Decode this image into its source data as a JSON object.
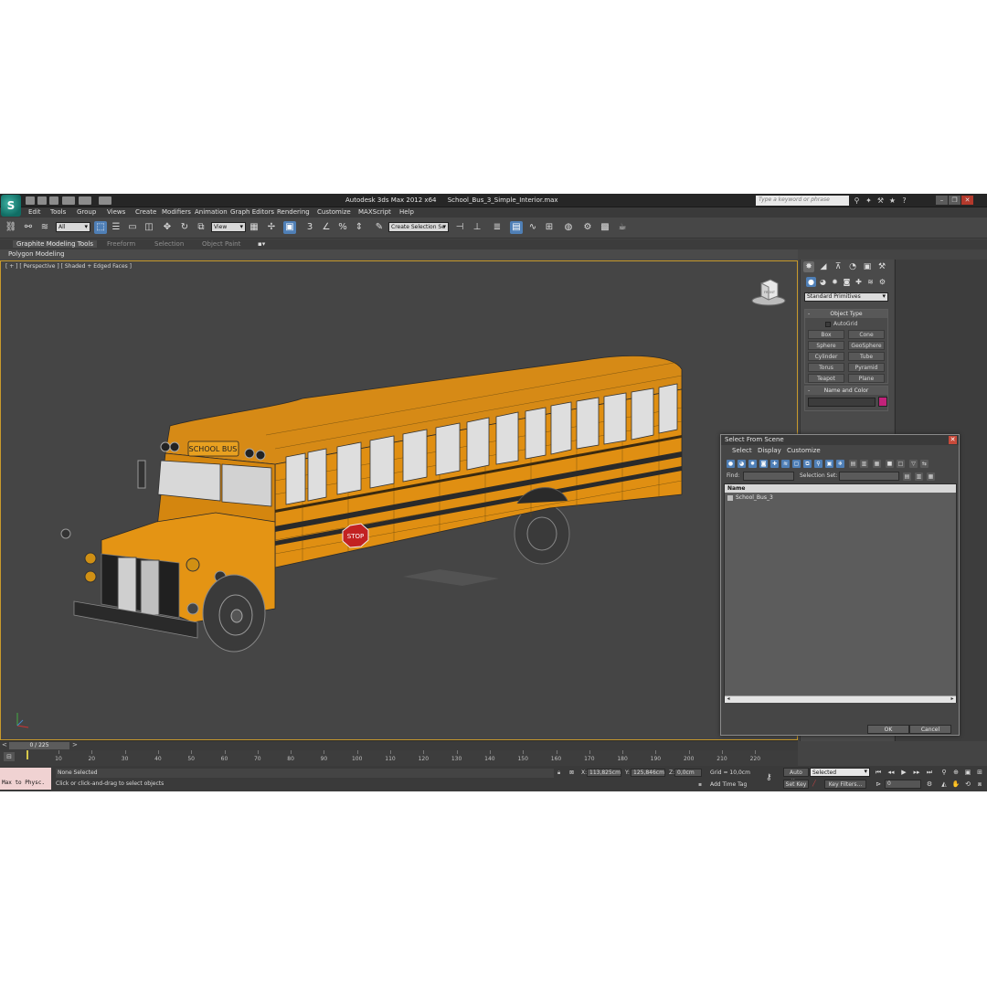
{
  "app": {
    "logo": "S",
    "title": "Autodesk 3ds Max  2012 x64",
    "filename": "School_Bus_3_Simple_Interior.max",
    "search_placeholder": "Type a keyword or phrase",
    "window_controls": [
      "minimize-icon",
      "restore-icon",
      "close-icon"
    ]
  },
  "menu": [
    "Edit",
    "Tools",
    "Group",
    "Views",
    "Create",
    "Modifiers",
    "Animation",
    "Graph Editors",
    "Rendering",
    "Customize",
    "MAXScript",
    "Help"
  ],
  "toolbar": {
    "selection_filter": "All",
    "reference_coord": "View",
    "named_selection": "Create Selection Se"
  },
  "ribbon": {
    "tabs": [
      "Graphite Modeling Tools",
      "Freeform",
      "Selection",
      "Object Paint"
    ],
    "active_tab": 0,
    "panel_label": "Polygon Modeling"
  },
  "viewport": {
    "label": "[ + ] [ Perspective ] [ Shaded + Edged Faces ]",
    "bus_sign": "SCHOOL BUS",
    "stop_sign": "STOP",
    "viewcube_label": "FRONT"
  },
  "command_panel": {
    "primitive_type": "Standard Primitives",
    "object_type_title": "Object Type",
    "autogrid_label": "AutoGrid",
    "object_buttons": [
      "Box",
      "Cone",
      "Sphere",
      "GeoSphere",
      "Cylinder",
      "Tube",
      "Torus",
      "Pyramid",
      "Teapot",
      "Plane"
    ],
    "name_color_title": "Name and Color",
    "object_color": "#c2227a"
  },
  "dialog": {
    "title": "Select From Scene",
    "menu": [
      "Select",
      "Display",
      "Customize"
    ],
    "find_label": "Find:",
    "selection_set_label": "Selection Set:",
    "column_header": "Name",
    "items": [
      "School_Bus_3"
    ],
    "ok_label": "OK",
    "cancel_label": "Cancel"
  },
  "timeline": {
    "frame_display": "0 / 225",
    "ticks": [
      "10",
      "20",
      "30",
      "40",
      "50",
      "60",
      "70",
      "80",
      "90",
      "100",
      "110",
      "120",
      "130",
      "140",
      "150",
      "160",
      "170",
      "180",
      "190",
      "200",
      "210",
      "220"
    ]
  },
  "status": {
    "maxscript_text": "Max to Physc.",
    "selection": "None Selected",
    "prompt": "Click or click-and-drag to select objects",
    "x_label": "X:",
    "x_value": "113,825cm",
    "y_label": "Y:",
    "y_value": "125,846cm",
    "z_label": "Z:",
    "z_value": "0,0cm",
    "grid": "Grid = 10,0cm",
    "add_time_tag": "Add Time Tag",
    "auto_key": "Auto Key",
    "set_key": "Set Key",
    "key_mode": "Selected",
    "key_filters": "Key Filters...",
    "current_frame": "0"
  }
}
